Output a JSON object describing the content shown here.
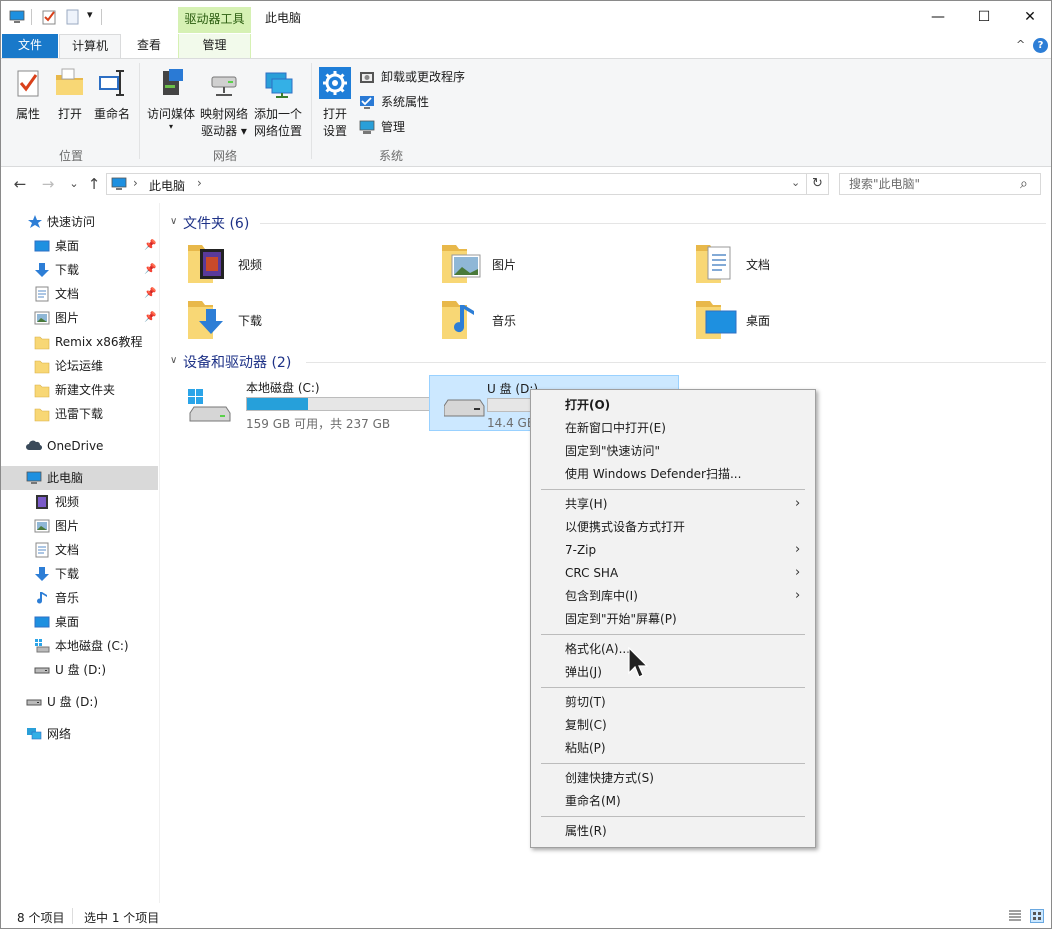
{
  "window": {
    "title": "此电脑",
    "context_group": "驱动器工具",
    "controls": {
      "minimize": "—",
      "maximize": "☐",
      "close": "✕"
    }
  },
  "quick_access_toolbar": {
    "dropdown": "▾"
  },
  "ribbon_tabs": {
    "file": "文件",
    "computer": "计算机",
    "view": "查看",
    "manage": "管理",
    "collapse": "^",
    "help": "?"
  },
  "ribbon": {
    "location": {
      "label": "位置",
      "properties": "属性",
      "open": "打开",
      "rename": "重命名"
    },
    "network": {
      "label": "网络",
      "access_media_line1": "访问媒体",
      "access_media_caret": "▾",
      "map_drive_line1": "映射网络",
      "map_drive_line2": "驱动器 ▾",
      "add_location_line1": "添加一个",
      "add_location_line2": "网络位置"
    },
    "system": {
      "label": "系统",
      "settings_line1": "打开",
      "settings_line2": "设置",
      "uninstall": "卸载或更改程序",
      "system_properties": "系统属性",
      "manage": "管理"
    }
  },
  "address_bar": {
    "back": "←",
    "forward": "→",
    "recent": "⌄",
    "up": "↑",
    "path": "此电脑",
    "path_chevron": "›",
    "path_chevron_end": "›",
    "dropdown": "⌄",
    "refresh": "↻",
    "search_placeholder": "搜索\"此电脑\"",
    "search_icon": "⌕"
  },
  "nav_pane": {
    "quick_access": "快速访问",
    "qa_desktop": "桌面",
    "qa_downloads": "下载",
    "qa_documents": "文档",
    "qa_pictures": "图片",
    "qa_remix": "Remix x86教程",
    "qa_forum": "论坛运维",
    "qa_newfolder": "新建文件夹",
    "qa_xunlei": "迅雷下载",
    "onedrive": "OneDrive",
    "this_pc": "此电脑",
    "pc_videos": "视频",
    "pc_pictures": "图片",
    "pc_documents": "文档",
    "pc_downloads": "下载",
    "pc_music": "音乐",
    "pc_desktop": "桌面",
    "pc_local_disk": "本地磁盘 (C:)",
    "pc_usb": "U 盘 (D:)",
    "usb_root": "U 盘 (D:)",
    "network": "网络",
    "pin": "📌"
  },
  "folders_section": {
    "title": "文件夹 (6)",
    "chevron": "∨",
    "videos": "视频",
    "pictures": "图片",
    "documents": "文档",
    "downloads": "下载",
    "music": "音乐",
    "desktop": "桌面"
  },
  "devices_section": {
    "title": "设备和驱动器 (2)",
    "chevron": "∨",
    "c_name": "本地磁盘 (C:)",
    "c_free": "159 GB 可用，共 237 GB",
    "c_used_fraction": 0.33,
    "d_name": "U 盘 (D:)",
    "d_free": "14.4 GB",
    "d_used_fraction": 0.0
  },
  "context_menu": {
    "open": "打开(O)",
    "open_new_window": "在新窗口中打开(E)",
    "pin_quick_access": "固定到\"快速访问\"",
    "defender_scan": "使用 Windows Defender扫描...",
    "share": "共享(H)",
    "open_portable": "以便携式设备方式打开",
    "sevenzip": "7-Zip",
    "crc_sha": "CRC SHA",
    "include_library": "包含到库中(I)",
    "pin_start": "固定到\"开始\"屏幕(P)",
    "format": "格式化(A)...",
    "eject": "弹出(J)",
    "cut": "剪切(T)",
    "copy": "复制(C)",
    "paste": "粘贴(P)",
    "create_shortcut": "创建快捷方式(S)",
    "rename": "重命名(M)",
    "properties": "属性(R)",
    "submenu_arrow": "›"
  },
  "status_bar": {
    "item_count": "8 个项目",
    "selected": "选中 1 个项目"
  },
  "colors": {
    "accent_blue": "#1979ca",
    "selection": "#cce8ff",
    "drive_bar": "#26a0da",
    "context_tab": "#d6f1b4",
    "folder_yellow": "#f8d775"
  }
}
